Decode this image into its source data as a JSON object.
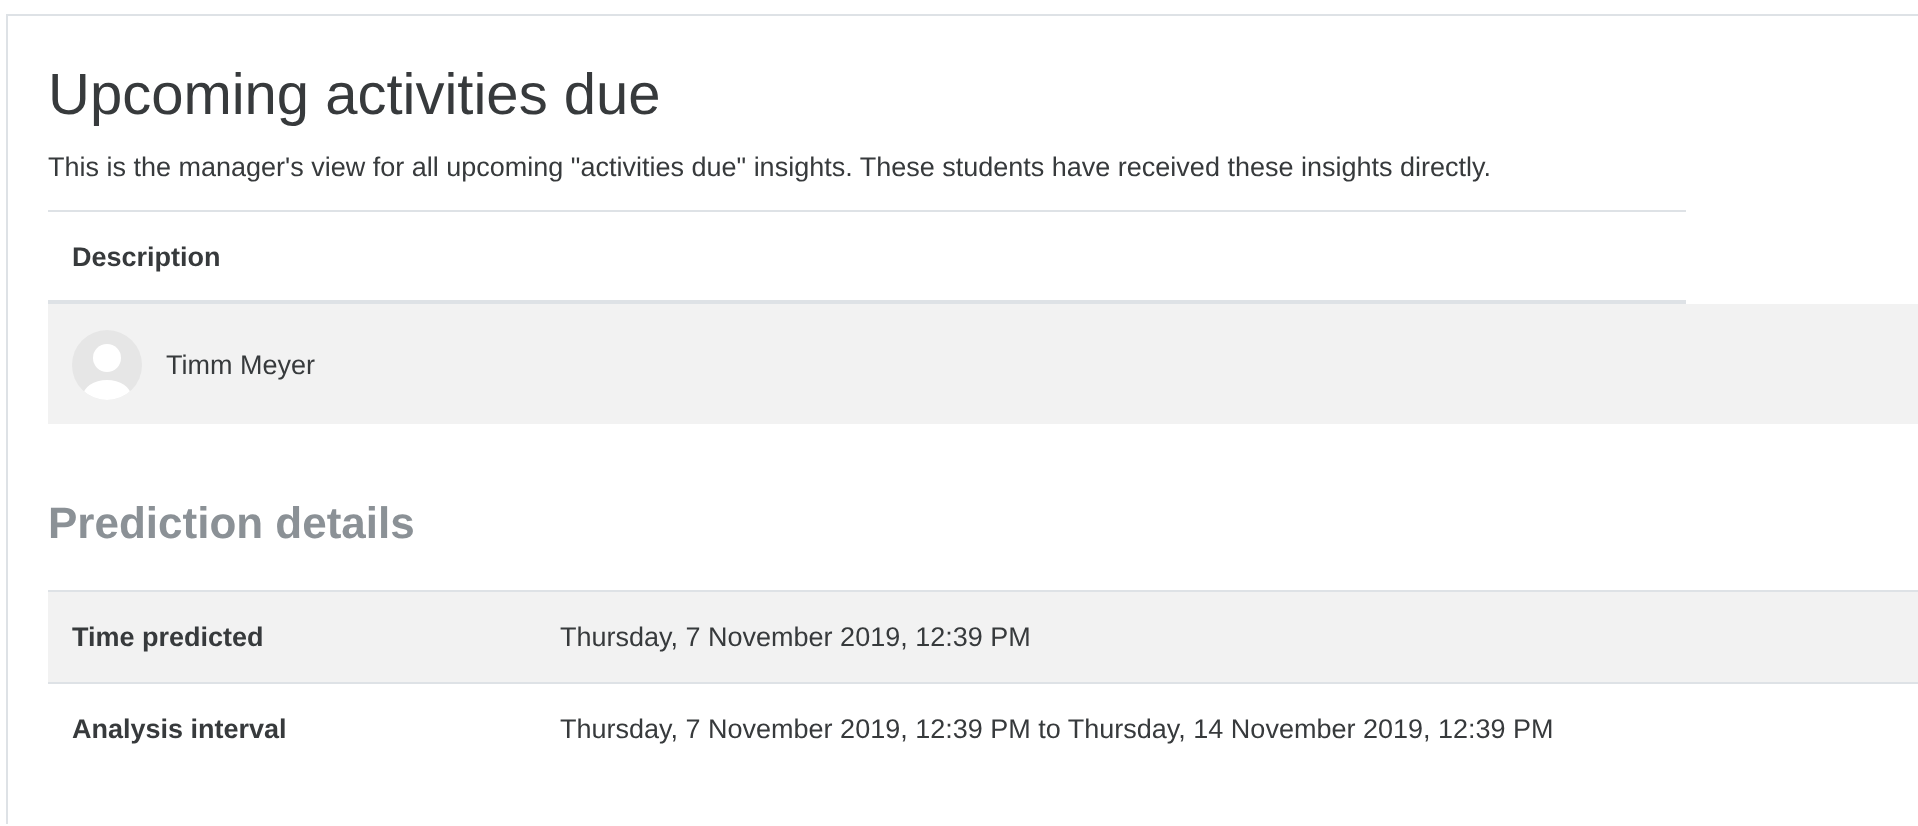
{
  "title": "Upcoming activities due",
  "intro": "This is the manager's view for all upcoming \"activities due\" insights. These students have received these insights directly.",
  "table": {
    "columns": [
      "Description"
    ],
    "rows": [
      {
        "name": "Timm Meyer"
      }
    ]
  },
  "details": {
    "heading": "Prediction details",
    "rows": [
      {
        "label": "Time predicted",
        "value": "Thursday, 7 November 2019, 12:39 PM"
      },
      {
        "label": "Analysis interval",
        "value": "Thursday, 7 November 2019, 12:39 PM to Thursday, 14 November 2019, 12:39 PM"
      }
    ]
  }
}
